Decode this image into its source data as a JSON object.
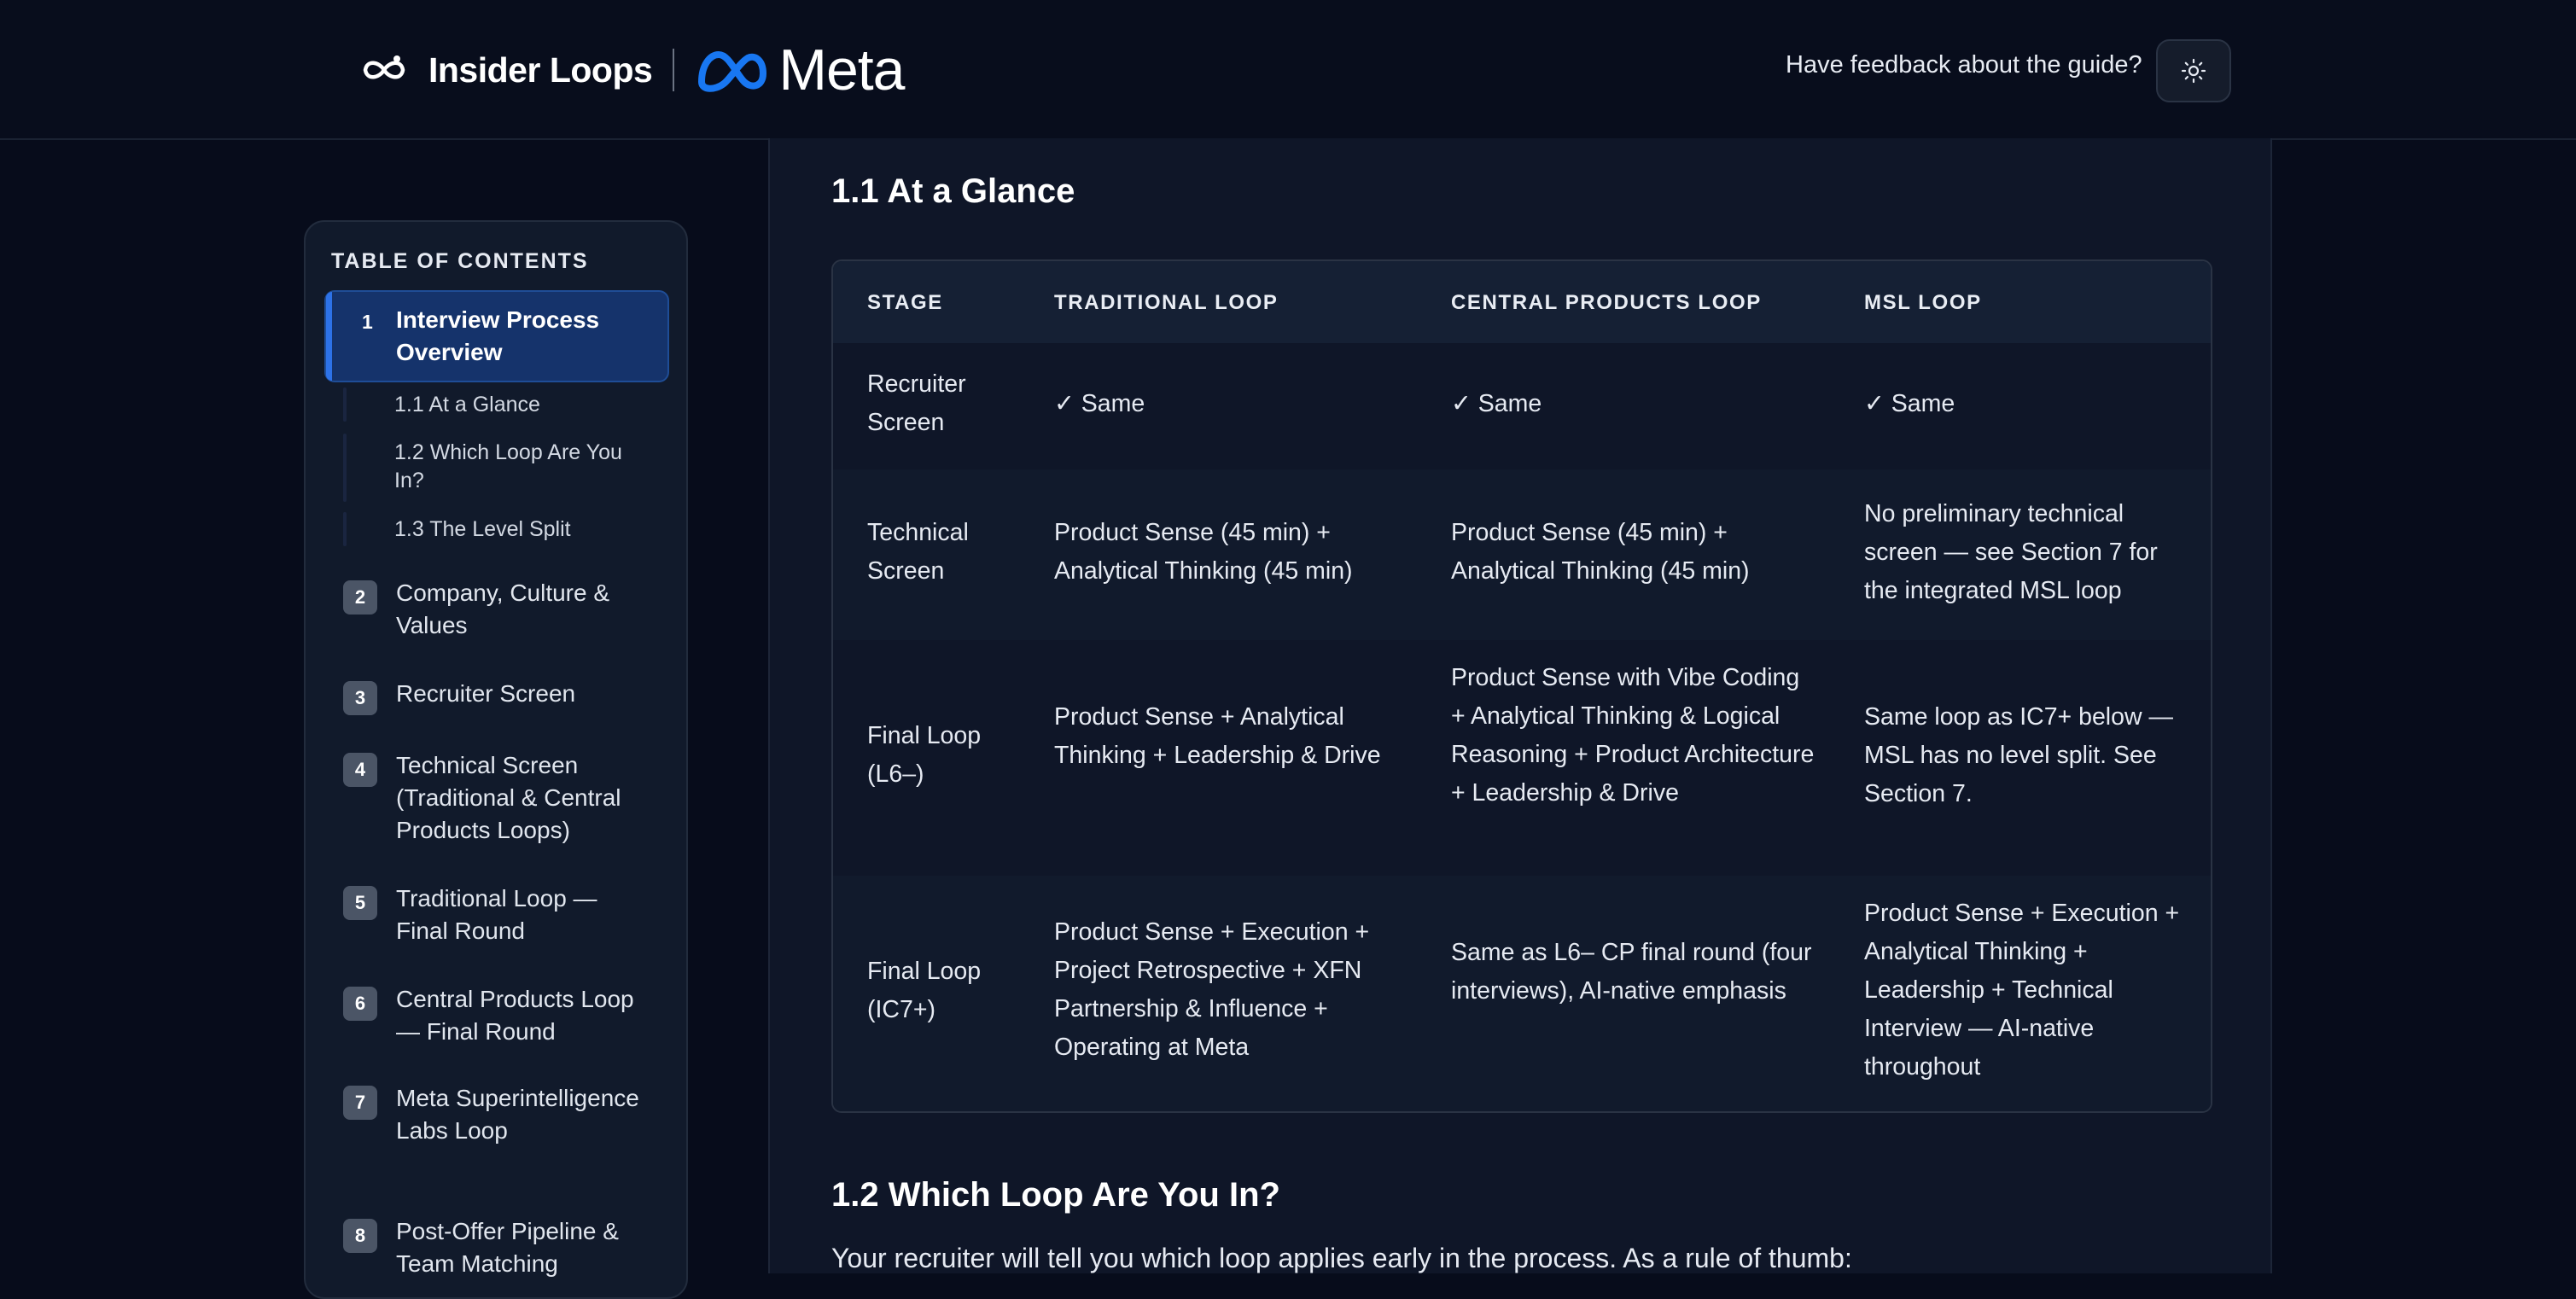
{
  "header": {
    "brand_name": "Insider Loops",
    "meta_wordmark": "Meta",
    "feedback_text": "Have feedback about the guide?",
    "theme_icon": "sun-icon"
  },
  "toc": {
    "title": "TABLE OF CONTENTS",
    "active": {
      "number": "1",
      "label": "Interview Process Overview"
    },
    "subsections": [
      {
        "label": "1.1 At a Glance"
      },
      {
        "label": "1.2 Which Loop Are You In?"
      },
      {
        "label": "1.3 The Level Split"
      }
    ],
    "items": [
      {
        "number": "2",
        "label": "Company, Culture & Values"
      },
      {
        "number": "3",
        "label": "Recruiter Screen"
      },
      {
        "number": "4",
        "label": "Technical Screen (Traditional & Central Products Loops)"
      },
      {
        "number": "5",
        "label": "Traditional Loop — Final Round"
      },
      {
        "number": "6",
        "label": "Central Products Loop — Final Round"
      },
      {
        "number": "7",
        "label": "Meta Superintelligence Labs Loop"
      },
      {
        "number": "8",
        "label": "Post-Offer Pipeline & Team Matching"
      }
    ]
  },
  "main": {
    "section_title": "1.1 At a Glance",
    "table": {
      "headers": [
        "STAGE",
        "TRADITIONAL LOOP",
        "CENTRAL PRODUCTS LOOP",
        "MSL LOOP"
      ],
      "rows": [
        [
          "Recruiter Screen",
          "✓ Same",
          "✓ Same",
          "✓ Same"
        ],
        [
          "Technical Screen",
          "Product Sense (45 min) + Analytical Thinking (45 min)",
          "Product Sense (45 min) + Analytical Thinking (45 min)",
          "No preliminary technical screen — see Section 7 for the integrated MSL loop"
        ],
        [
          "Final Loop (L6–)",
          "Product Sense + Analytical Thinking + Leadership & Drive",
          "Product Sense with Vibe Coding + Analytical Thinking & Logical Reasoning + Product Architecture + Leadership & Drive",
          "Same loop as IC7+ below — MSL has no level split. See Section 7."
        ],
        [
          "Final Loop (IC7+)",
          "Product Sense + Execution + Project Retrospective + XFN Partnership & Influence + Operating at Meta",
          "Same as L6– CP final round (four interviews), AI-native emphasis",
          "Product Sense + Execution + Analytical Thinking + Leadership + Technical Interview — AI-native throughout"
        ]
      ]
    },
    "next_section_title": "1.2 Which Loop Are You In?",
    "next_intro": "Your recruiter will tell you which loop applies early in the process. As a rule of thumb:"
  }
}
